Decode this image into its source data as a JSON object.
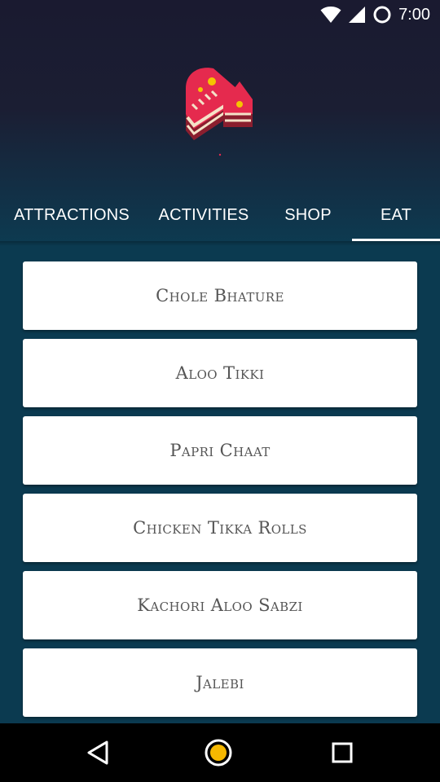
{
  "status_bar": {
    "time": "7:00",
    "icons": [
      "wifi-icon",
      "cell-signal-icon",
      "ring-icon"
    ]
  },
  "header": {
    "logo": "cake-slice-logo"
  },
  "tabs": [
    {
      "label": "ATTRACTIONS",
      "active": false
    },
    {
      "label": "ACTIVITIES",
      "active": false
    },
    {
      "label": "SHOP",
      "active": false
    },
    {
      "label": "EAT",
      "active": true
    }
  ],
  "eat_list": [
    {
      "label": "Chole Bhature"
    },
    {
      "label": "Aloo Tikki"
    },
    {
      "label": "Papri Chaat"
    },
    {
      "label": "Chicken Tikka Rolls"
    },
    {
      "label": "Kachori Aloo Sabzi"
    },
    {
      "label": "Jalebi"
    }
  ],
  "nav_bar": {
    "icons": [
      "back-icon",
      "home-icon",
      "recents-icon"
    ]
  },
  "colors": {
    "header_top": "#1a1a30",
    "content_bg": "#0b3a50",
    "card_bg": "#ffffff",
    "card_text": "#555555",
    "home_accent": "#f5b800"
  }
}
